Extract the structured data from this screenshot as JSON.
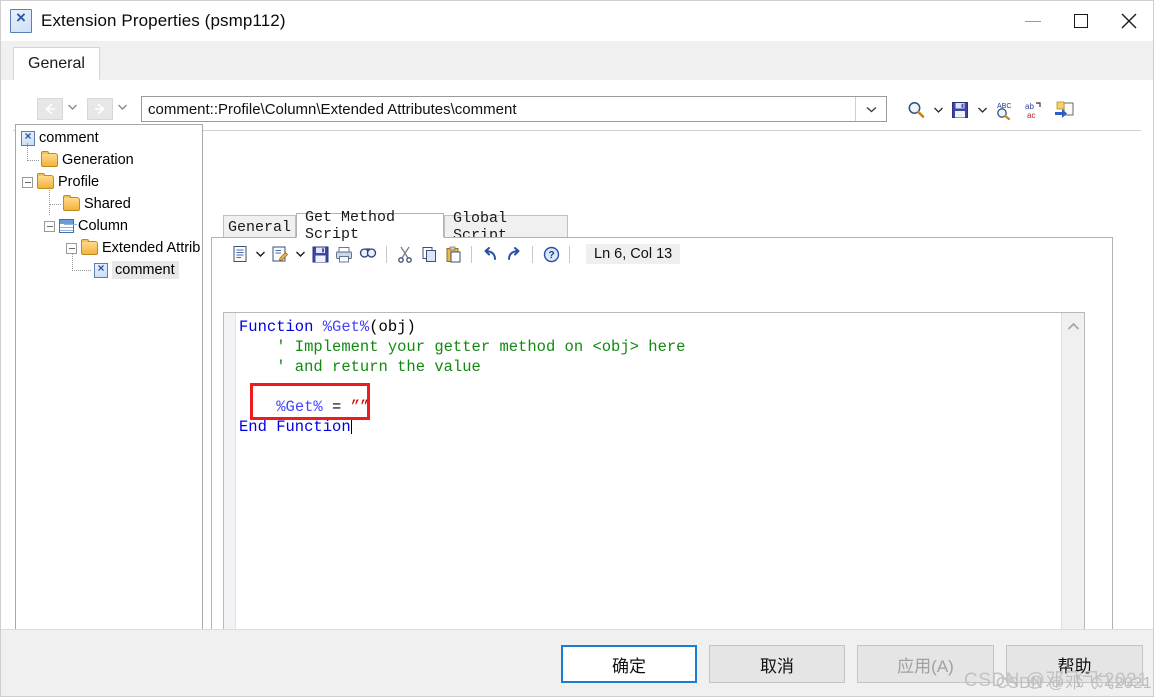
{
  "window": {
    "title": "Extension Properties (psmp112)",
    "icon": "extension-document-icon",
    "controls": {
      "minimize": "minimize-icon",
      "maximize": "maximize-icon",
      "close": "close-icon"
    }
  },
  "outer_tabs": [
    {
      "label": "General",
      "active": true
    }
  ],
  "nav": {
    "back": "←",
    "forward": "→",
    "back_caret": "chevron-down-icon",
    "forward_caret": "chevron-down-icon"
  },
  "path": {
    "value": "comment::Profile\\Column\\Extended Attributes\\comment",
    "dropdown": "chevron-down-icon"
  },
  "top_icons": [
    {
      "name": "search-icon",
      "glyph": "🔍"
    },
    {
      "name": "search-dropdown-caret",
      "glyph": "▾"
    },
    {
      "name": "save-icon",
      "glyph": "💾"
    },
    {
      "name": "save-dropdown-caret",
      "glyph": "▾"
    },
    {
      "name": "spell-check-icon",
      "glyph": "ABC"
    },
    {
      "name": "replace-icon",
      "glyph": "ab→ac"
    },
    {
      "name": "export-icon",
      "glyph": "➡"
    }
  ],
  "tree": {
    "nodes": [
      {
        "label": "comment",
        "icon": "document-x-icon",
        "indent": 0,
        "expander": false,
        "selected": false
      },
      {
        "label": "Generation",
        "icon": "folder-icon",
        "indent": 1,
        "expander": false,
        "selected": false
      },
      {
        "label": "Profile",
        "icon": "folder-icon",
        "indent": 1,
        "expander": true,
        "selected": false
      },
      {
        "label": "Shared",
        "icon": "folder-icon",
        "indent": 2,
        "expander": false,
        "selected": false
      },
      {
        "label": "Column",
        "icon": "table-icon",
        "indent": 2,
        "expander": true,
        "selected": false
      },
      {
        "label": "Extended Attrib",
        "icon": "folder-icon",
        "indent": 3,
        "expander": true,
        "selected": false
      },
      {
        "label": "comment",
        "icon": "document-x-icon",
        "indent": 4,
        "expander": false,
        "selected": true
      }
    ],
    "hscroll": {
      "left_arrow": "chevron-left-icon",
      "right_arrow": "chevron-right-icon"
    }
  },
  "editor": {
    "tabs": [
      {
        "label": "General",
        "active": false
      },
      {
        "label": "Get Method Script",
        "active": true
      },
      {
        "label": "Global Script",
        "active": false
      }
    ],
    "toolbar": {
      "icons": [
        {
          "name": "open-script-icon",
          "glyph": "☰"
        },
        {
          "name": "open-dropdown-caret",
          "glyph": "▾"
        },
        {
          "name": "edit-script-icon",
          "glyph": "✎"
        },
        {
          "name": "edit-dropdown-caret",
          "glyph": "▾"
        },
        {
          "name": "save-icon",
          "glyph": "💾"
        },
        {
          "name": "print-icon",
          "glyph": "🖨"
        },
        {
          "name": "find-icon",
          "glyph": "🔎"
        },
        {
          "name": "cut-icon",
          "glyph": "✂"
        },
        {
          "name": "copy-icon",
          "glyph": "⧉"
        },
        {
          "name": "paste-icon",
          "glyph": "📋"
        },
        {
          "name": "undo-icon",
          "glyph": "↶"
        },
        {
          "name": "redo-icon",
          "glyph": "↷"
        },
        {
          "name": "help-icon",
          "glyph": "?"
        }
      ],
      "status": "Ln 6, Col 13"
    },
    "code_lines": [
      [
        {
          "t": "Function ",
          "c": "kw"
        },
        {
          "t": "%Get%",
          "c": "id"
        },
        {
          "t": "(obj)",
          "c": "pl"
        }
      ],
      [
        {
          "t": "    ' Implement your getter method on <obj> here",
          "c": "cm"
        }
      ],
      [
        {
          "t": "    ' and return the value",
          "c": "cm"
        }
      ],
      [
        {
          "t": "",
          "c": "pl"
        }
      ],
      [
        {
          "t": "    ",
          "c": "pl"
        },
        {
          "t": "%Get%",
          "c": "id"
        },
        {
          "t": " = ",
          "c": "pl"
        },
        {
          "t": "””",
          "c": "str"
        }
      ],
      [
        {
          "t": "End Function",
          "c": "kw"
        }
      ]
    ],
    "annotation": {
      "name": "red-highlight-box",
      "color": "#ee1c1c"
    },
    "vscroll": {
      "up": "chevron-up-icon",
      "down": "chevron-down-icon"
    },
    "hscroll": {
      "left": "chevron-left-icon",
      "right": "chevron-right-icon"
    }
  },
  "buttons": [
    {
      "label": "确定",
      "name": "ok-button",
      "style": "primary",
      "disabled": false
    },
    {
      "label": "取消",
      "name": "cancel-button",
      "style": "normal",
      "disabled": false
    },
    {
      "label": "应用(A)",
      "name": "apply-button",
      "style": "normal",
      "disabled": true
    },
    {
      "label": "帮助",
      "name": "help-button",
      "style": "normal",
      "disabled": false
    }
  ],
  "watermark": {
    "line1": "CSDN @邓飞飞2021",
    "line2": "CSDN @邓飞飞2021"
  }
}
